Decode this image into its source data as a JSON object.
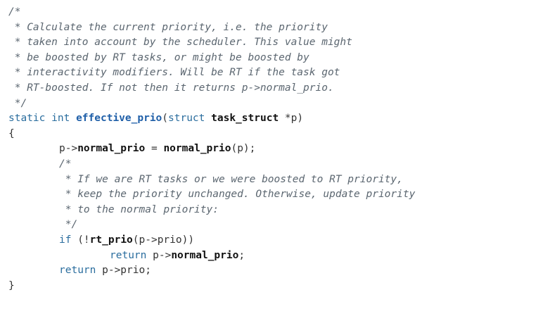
{
  "code": {
    "comment_open": "/*",
    "comment_lines": [
      " * Calculate the current priority, i.e. the priority",
      " * taken into account by the scheduler. This value might",
      " * be boosted by RT tasks, or might be boosted by",
      " * interactivity modifiers. Will be RT if the task got",
      " * RT-boosted. If not then it returns p->normal_prio."
    ],
    "comment_close": " */",
    "signature": {
      "kw_static": "static",
      "kw_int": "int",
      "fn_name": "effective_prio",
      "paren_open": "(",
      "kw_struct": "struct",
      "type_name": "task_struct",
      "param": " *p)"
    },
    "brace_open": "{",
    "assign": {
      "lhs_prefix": "p->",
      "lhs_field": "normal_prio",
      "op": " = ",
      "call_name": "normal_prio",
      "call_args": "(p);"
    },
    "inner_comment_open": "/*",
    "inner_comment_lines": [
      " * If we are RT tasks or we were boosted to RT priority,",
      " * keep the priority unchanged. Otherwise, update priority",
      " * to the normal priority:"
    ],
    "inner_comment_close": " */",
    "if_stmt": {
      "kw_if": "if",
      "open": " (!",
      "call_name": "rt_prio",
      "args": "(p->prio))"
    },
    "return_boosted": {
      "kw_return": "return",
      "prefix": " p->",
      "field": "normal_prio",
      "end": ";"
    },
    "return_prio": {
      "kw_return": "return",
      "rest": " p->prio;"
    },
    "brace_close": "}"
  }
}
